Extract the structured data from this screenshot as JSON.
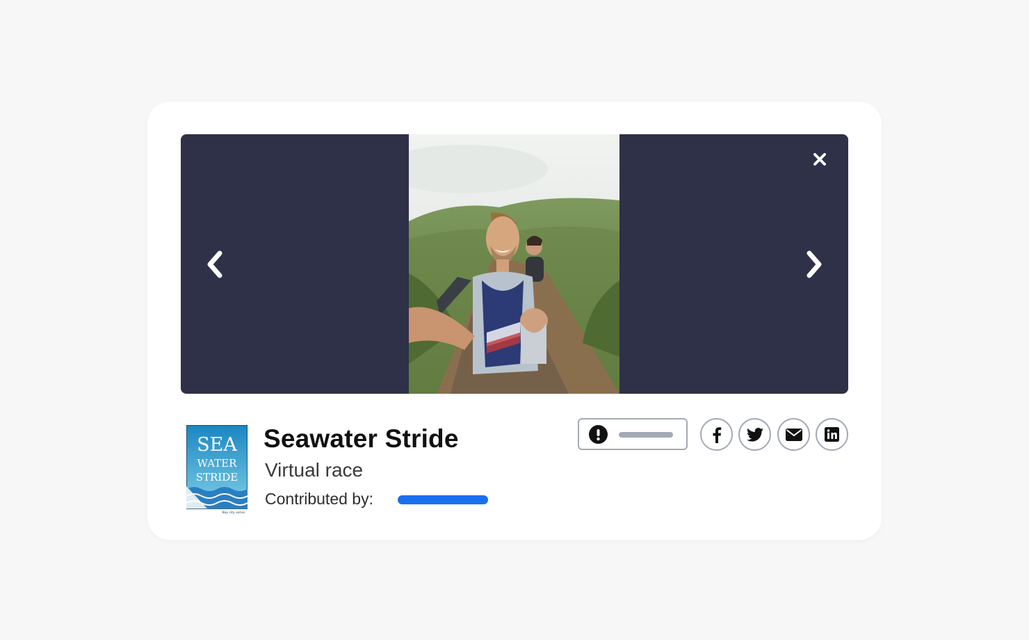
{
  "event": {
    "title": "Seawater Stride",
    "subtitle": "Virtual race",
    "contributed_label": "Contributed by:"
  },
  "logo": {
    "line1": "SEA",
    "line2": "WATER",
    "line3": "STRIDE",
    "tagline": "Bay city series"
  },
  "viewer": {
    "photo_alt": "Selfie of hikers on a mountain trail"
  },
  "icons": {
    "prev": "chevron-left-icon",
    "next": "chevron-right-icon",
    "close": "close-icon",
    "report": "exclamation-circle-icon",
    "facebook": "facebook-icon",
    "twitter": "twitter-icon",
    "email": "envelope-icon",
    "linkedin": "linkedin-icon"
  },
  "colors": {
    "viewer_bg": "#2e3147",
    "link_accent": "#1a6ff0",
    "button_border": "#a3a9b6",
    "logo_blue": "#1f8fc8"
  }
}
